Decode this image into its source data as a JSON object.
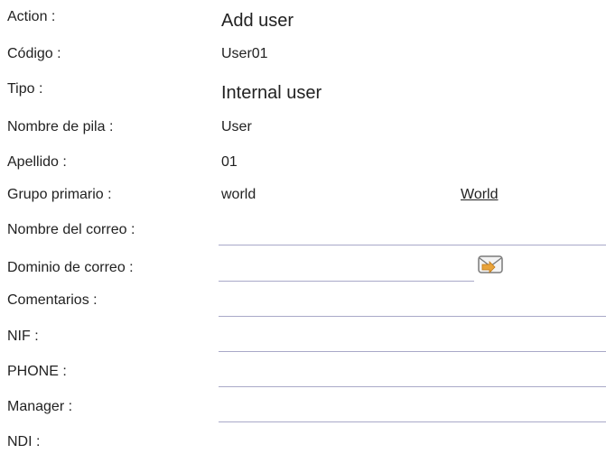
{
  "form": {
    "action": {
      "label": "Action :",
      "value": "Add user"
    },
    "codigo": {
      "label": "Código :",
      "value": "User01"
    },
    "tipo": {
      "label": "Tipo :",
      "value": "Internal user"
    },
    "nombre": {
      "label": "Nombre de pila :",
      "value": "User"
    },
    "apellido": {
      "label": "Apellido :",
      "value": "01"
    },
    "grupo": {
      "label": "Grupo primario :",
      "value": "world",
      "link": "World"
    },
    "nombre_correo": {
      "label": "Nombre del correo :",
      "value": ""
    },
    "dominio_correo": {
      "label": "Dominio de correo :",
      "value": "",
      "icon": "mail-envelope-icon"
    },
    "comentarios": {
      "label": "Comentarios :",
      "value": ""
    },
    "nif": {
      "label": "NIF :",
      "value": ""
    },
    "phone": {
      "label": "PHONE :",
      "value": ""
    },
    "manager": {
      "label": "Manager :",
      "value": ""
    },
    "ndi": {
      "label": "NDI :"
    }
  },
  "colors": {
    "field_underline": "#a9a9c8",
    "icon_orange": "#e8a33a"
  }
}
